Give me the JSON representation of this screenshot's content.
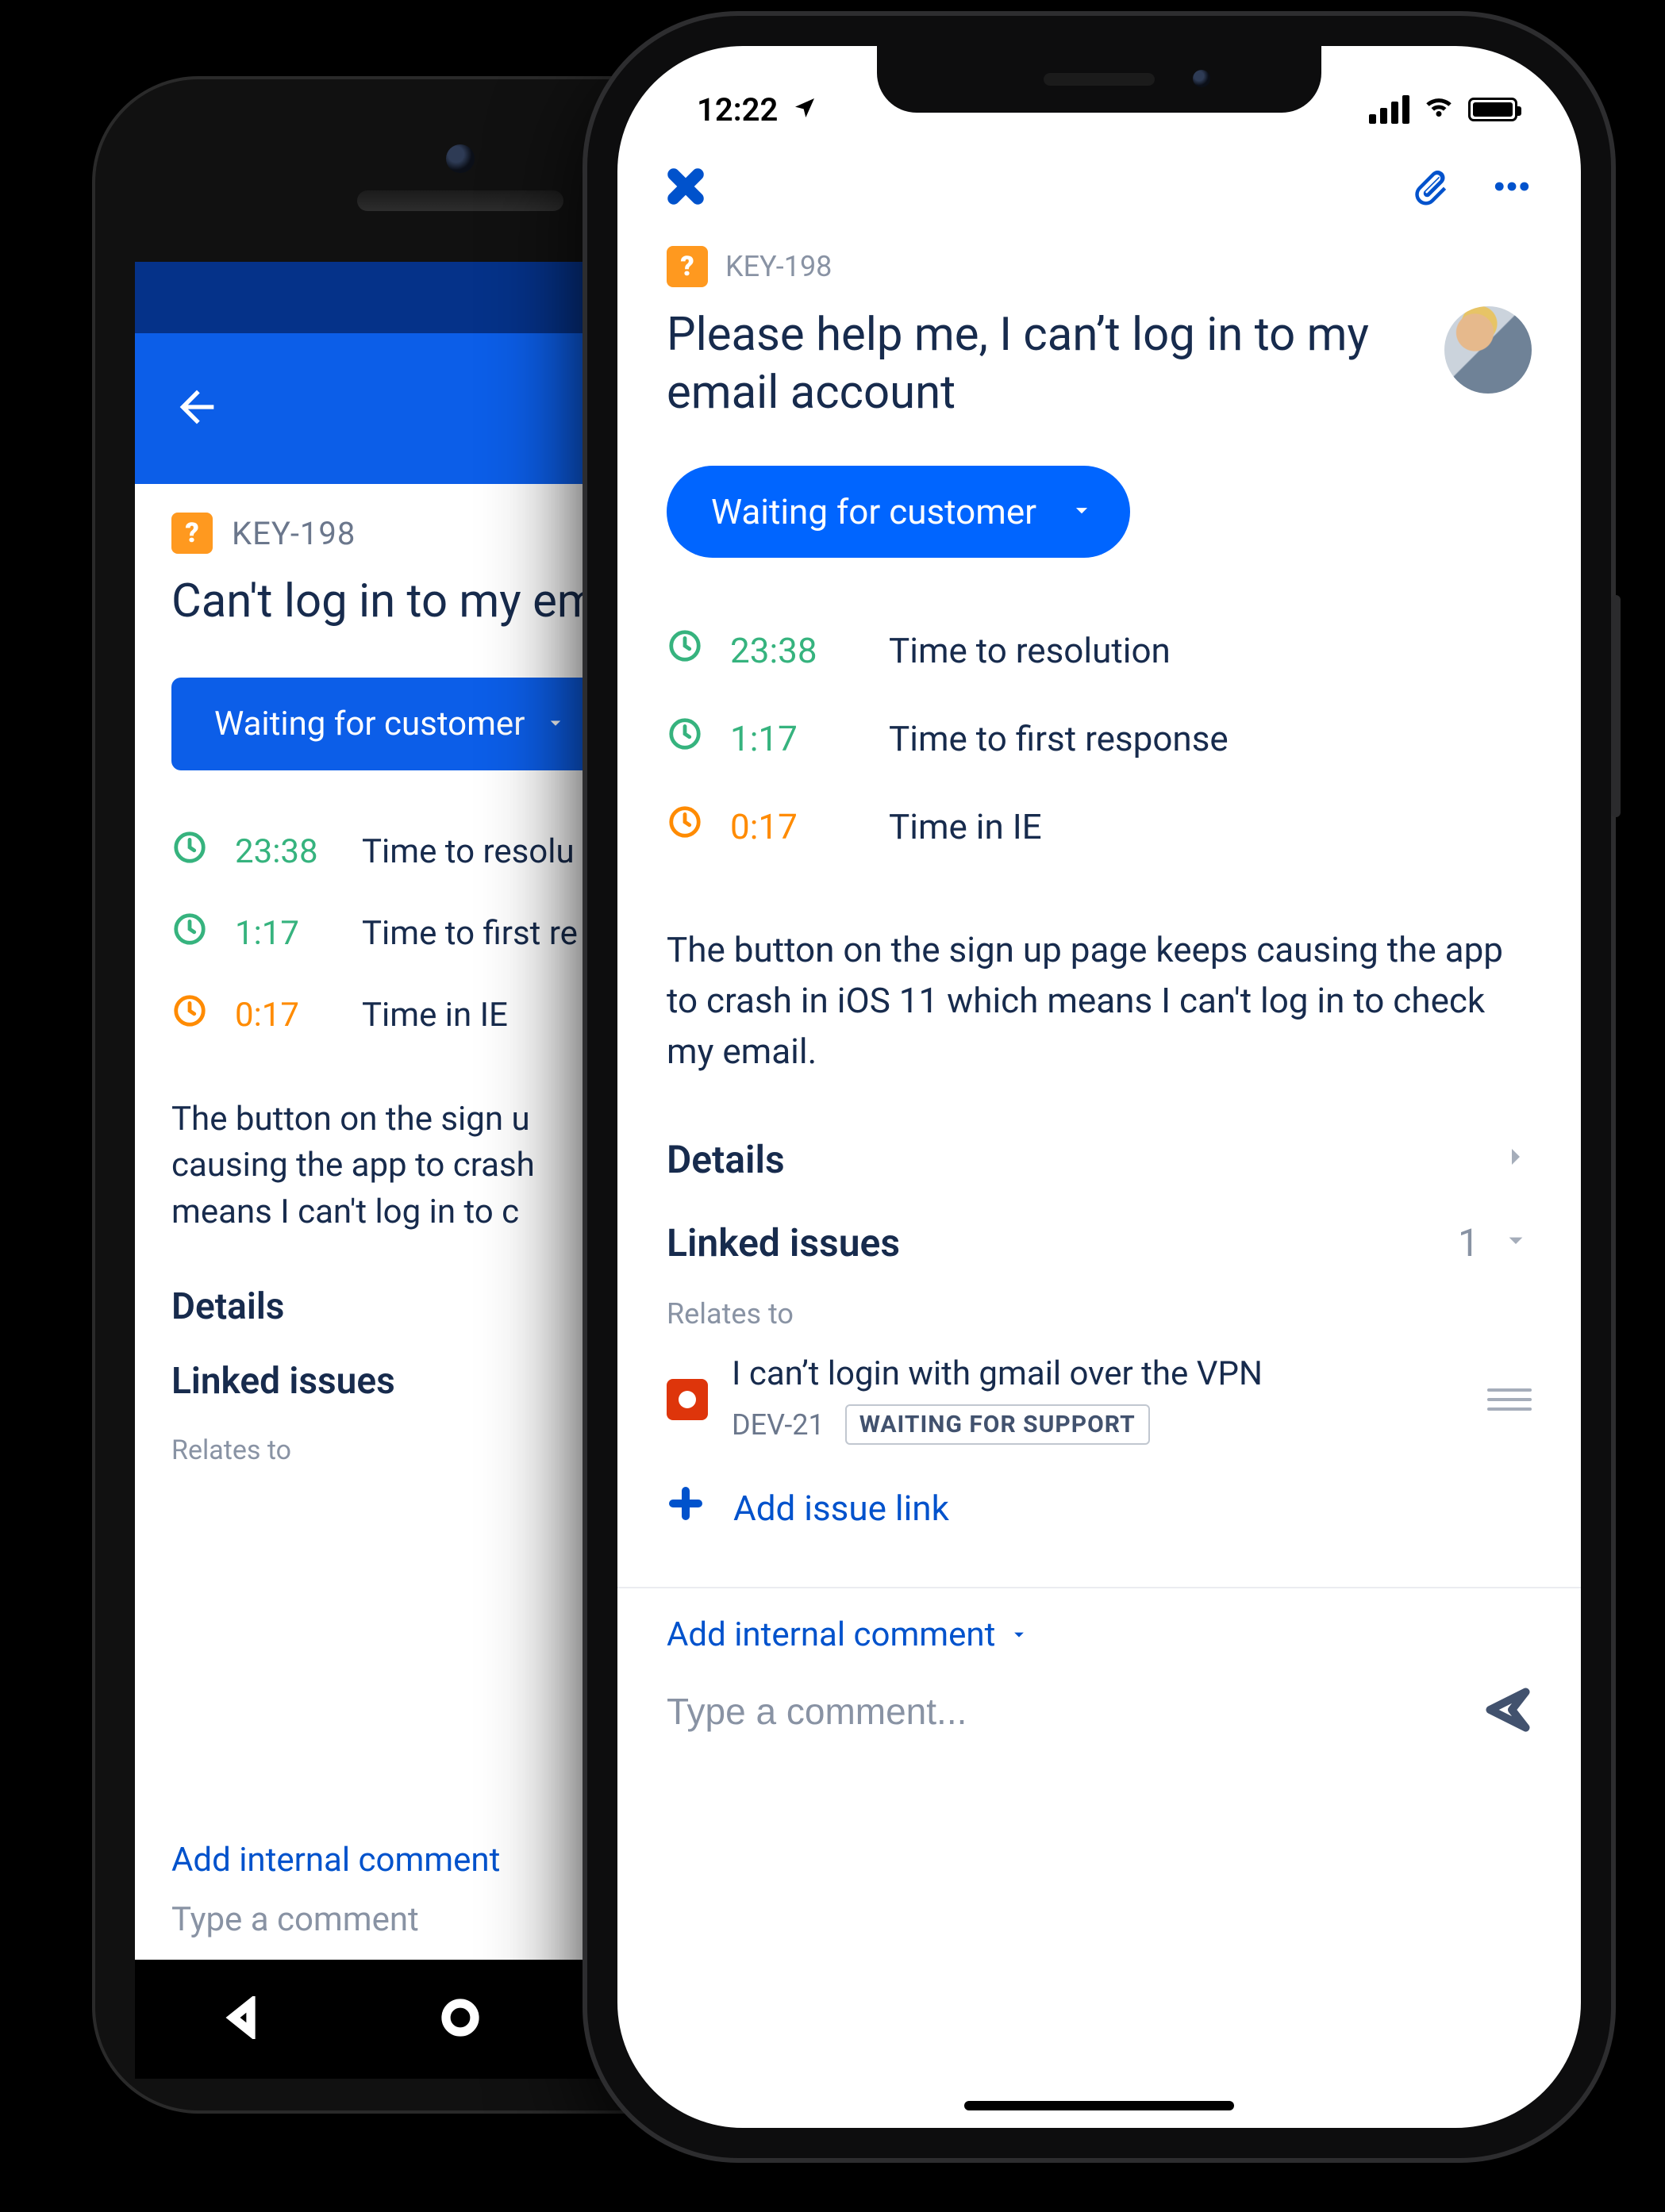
{
  "android": {
    "issue_key": "KEY-198",
    "title": "Can't log in to my em",
    "status_label": "Waiting for customer",
    "sla": [
      {
        "time": "23:38",
        "label": "Time to resolu",
        "color": "green"
      },
      {
        "time": "1:17",
        "label": "Time to first re",
        "color": "green"
      },
      {
        "time": "0:17",
        "label": "Time in IE",
        "color": "orange"
      }
    ],
    "description": "The button on the sign u\ncausing the app to crash\nmeans I can't log in to c",
    "details_label": "Details",
    "linked_label": "Linked issues",
    "relates_label": "Relates to",
    "add_internal": "Add internal comment",
    "comment_placeholder": "Type a comment"
  },
  "ios": {
    "clock": "12:22",
    "issue_key": "KEY-198",
    "title": "Please help me, I can’t log in to my email account",
    "status_label": "Waiting for customer",
    "sla": [
      {
        "time": "23:38",
        "label": "Time to resolution",
        "color": "green"
      },
      {
        "time": "1:17",
        "label": "Time to first response",
        "color": "green"
      },
      {
        "time": "0:17",
        "label": "Time in IE",
        "color": "orange"
      }
    ],
    "description": "The button on the sign up page keeps causing the app to crash in iOS 11 which means I can't log in to check my email.",
    "details_label": "Details",
    "linked_label": "Linked issues",
    "linked_count": "1",
    "relates_label": "Relates to",
    "linked_issue": {
      "summary": "I can’t login with gmail over the VPN",
      "key": "DEV-21",
      "status": "WAITING FOR SUPPORT"
    },
    "add_issue_link": "Add issue link",
    "add_internal": "Add internal comment",
    "comment_placeholder": "Type a comment..."
  }
}
